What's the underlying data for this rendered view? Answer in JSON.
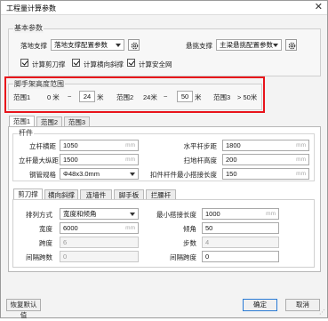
{
  "window": {
    "title": "工程量计算参数",
    "close_glyph": "✕"
  },
  "basic": {
    "legend": "基本参数",
    "floor_support_label": "落地支撑",
    "floor_support_value": "落地支撑配置参数",
    "cantilever_label": "悬挑支撑",
    "cantilever_value": "主梁悬挑配置参数",
    "check_scissor": "计算剪刀撑",
    "check_cross": "计算横向斜撑",
    "check_net": "计算安全网"
  },
  "height_range": {
    "legend": "脚手架高度范围",
    "r1_label": "范围1",
    "r1_from": "0 米",
    "tilde1": "~",
    "r1_to": "24",
    "r1_unit": "米",
    "r2_label": "范围2",
    "r2_from": "24米",
    "tilde2": "~",
    "r2_to": "50",
    "r2_unit": "米",
    "r3_label": "范围3",
    "r3_value": "> 50米"
  },
  "range_tabs": [
    "范围1",
    "范围2",
    "范围3"
  ],
  "pole": {
    "legend": "杆件",
    "vertical_spacing_label": "立杆横距",
    "vertical_spacing_value": "1050",
    "longitudinal_spacing_label": "立杆最大纵距",
    "longitudinal_spacing_value": "1500",
    "steel_label": "钢管规格",
    "steel_value": "Φ48x3.0mm",
    "horizontal_step_label": "水平杆步距",
    "horizontal_step_value": "1800",
    "sweep_height_label": "扫地杆高度",
    "sweep_height_value": "200",
    "fastener_label": "扣件杆件最小搭接长度",
    "fastener_value": "150",
    "unit": "mm"
  },
  "sub_tabs": [
    "剪刀撑",
    "横向斜撑",
    "连墙件",
    "脚手板",
    "拦腰杆"
  ],
  "scissor": {
    "arrangement_label": "排列方式",
    "arrangement_value": "宽度和倾角",
    "width_label": "宽度",
    "width_value": "6000",
    "span_label": "跨度",
    "span_value": "6",
    "gap_span_label": "间隔跨数",
    "gap_span_value": "0",
    "min_overlap_label": "最小搭接长度",
    "min_overlap_value": "1000",
    "angle_label": "倾角",
    "angle_value": "50",
    "steps_label": "步数",
    "steps_value": "4",
    "gap_steps_label": "间隔跨度",
    "gap_steps_value": "0",
    "unit": "mm"
  },
  "footer": {
    "restore_label": "恢复默认值",
    "ok_label": "确定",
    "cancel_label": "取消"
  }
}
